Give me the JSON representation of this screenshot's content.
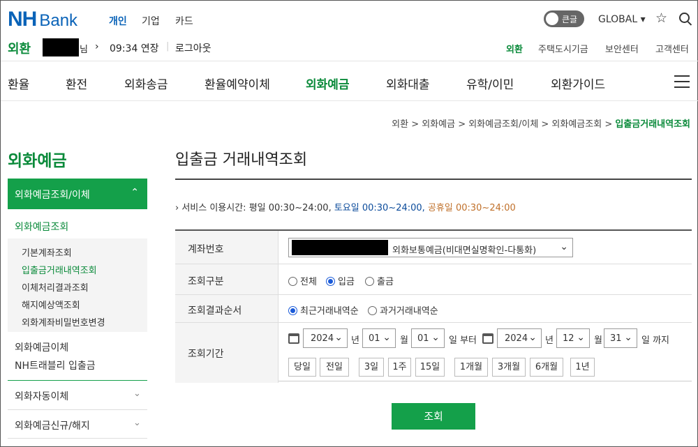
{
  "header": {
    "logo_nh": "NH",
    "logo_bank": "Bank",
    "top_nav": [
      "개인",
      "기업",
      "카드"
    ],
    "toggle_label": "큰글",
    "global_label": "GLOBAL ▾",
    "section_label": "외환",
    "user_suffix": "님",
    "timer": "09:34 연장",
    "logout": "로그아웃",
    "util_links": [
      "외환",
      "주택도시기금",
      "보안센터",
      "고객센터"
    ]
  },
  "main_nav": [
    "환율",
    "환전",
    "외화송금",
    "환율예약이체",
    "외화예금",
    "외화대출",
    "유학/이민",
    "외환가이드"
  ],
  "breadcrumb": {
    "path": "외환 > 외화예금 > 외화예금조회/이체 > 외화예금조회 > ",
    "current": "입출금거래내역조회"
  },
  "sidebar": {
    "title": "외화예금",
    "active_group": "외화예금조회/이체",
    "sub_title": "외화예금조회",
    "sub_items": [
      "기본계좌조회",
      "입출금거래내역조회",
      "이체처리결과조회",
      "해지예상액조회",
      "외화계좌비밀번호변경"
    ],
    "links": [
      "외화예금이체",
      "NH트래블리 입출금"
    ],
    "groups": [
      "외화자동이체",
      "외화예금신규/해지"
    ]
  },
  "content": {
    "title": "입출금 거래내역조회",
    "service_hours": {
      "prefix": "› 서비스 이용시간: 평일 00:30~24:00,",
      "sat": "토요일 00:30~24:00,",
      "hol": "공휴일 00:30~24:00"
    },
    "form": {
      "account_label": "계좌번호",
      "account_type": "외화보통예금(비대면실명확인-다통화)",
      "inquiry_label": "조회구분",
      "inquiry_options": [
        "전체",
        "입금",
        "출금"
      ],
      "order_label": "조회결과순서",
      "order_options": [
        "최근거래내역순",
        "과거거래내역순"
      ],
      "period_label": "조회기간",
      "start": {
        "year": "2024",
        "month": "01",
        "day": "01"
      },
      "end": {
        "year": "2024",
        "month": "12",
        "day": "31"
      },
      "unit_year": "년",
      "unit_month": "월",
      "unit_day_from": "일 부터",
      "unit_day_to": "일 까지",
      "quick_buttons": [
        "당일",
        "전일",
        "3일",
        "1주",
        "15일",
        "1개월",
        "3개월",
        "6개월",
        "1년"
      ]
    },
    "search_button": "조회"
  }
}
